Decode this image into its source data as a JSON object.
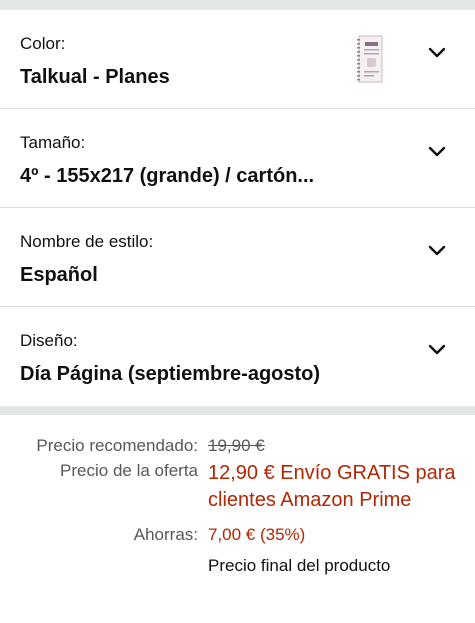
{
  "options": [
    {
      "label": "Color:",
      "value": "Talkual - Planes",
      "has_swatch": true
    },
    {
      "label": "Tamaño:",
      "value": "4º - 155x217 (grande) / cartón..."
    },
    {
      "label": "Nombre de estilo:",
      "value": "Español"
    },
    {
      "label": "Diseño:",
      "value": "Día Página (septiembre-agosto)"
    }
  ],
  "icons": {
    "chevron": "chevron-down-icon",
    "swatch": "product-swatch-thumbnail"
  },
  "pricing": {
    "list_price_label": "Precio recomendado:",
    "list_price_value": "19,90 €",
    "deal_label": "Precio de la oferta",
    "deal_value": "12,90 € Envío GRATIS para clientes Amazon Prime",
    "savings_label": "Ahorras:",
    "savings_value": "7,00 € (35%)",
    "final_note": "Precio final del producto"
  },
  "colors": {
    "band": "#e3e6e6",
    "deal_red": "#b12704",
    "muted_text": "#565959",
    "primary_text": "#0f1111"
  }
}
